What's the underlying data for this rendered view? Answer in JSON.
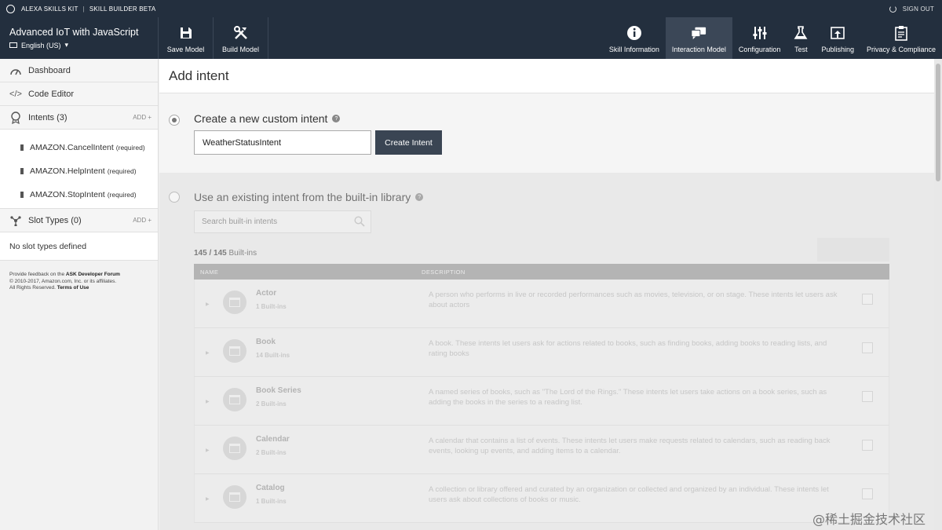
{
  "topbar": {
    "brand": "ALEXA SKILLS KIT",
    "separator": "|",
    "product": "SKILL BUILDER BETA",
    "signout": "SIGN OUT"
  },
  "header": {
    "skill_title": "Advanced IoT with JavaScript",
    "language": "English (US)",
    "left_buttons": [
      {
        "label": "Save Model",
        "icon": "save-icon"
      },
      {
        "label": "Build Model",
        "icon": "tools-icon"
      }
    ],
    "right_buttons": [
      {
        "label": "Skill Information",
        "icon": "info-icon"
      },
      {
        "label": "Interaction Model",
        "icon": "chat-icon",
        "active": true
      },
      {
        "label": "Configuration",
        "icon": "sliders-icon"
      },
      {
        "label": "Test",
        "icon": "flask-icon"
      },
      {
        "label": "Publishing",
        "icon": "upload-icon"
      },
      {
        "label": "Privacy & Compliance",
        "icon": "clipboard-icon"
      }
    ]
  },
  "sidebar": {
    "dashboard": "Dashboard",
    "code_editor": "Code Editor",
    "intents_label": "Intents (3)",
    "add_label": "ADD +",
    "intents": [
      {
        "name": "AMAZON.CancelIntent",
        "tag": "(required)"
      },
      {
        "name": "AMAZON.HelpIntent",
        "tag": "(required)"
      },
      {
        "name": "AMAZON.StopIntent",
        "tag": "(required)"
      }
    ],
    "slot_types_label": "Slot Types (0)",
    "no_slots": "No slot types defined",
    "feedback": {
      "line1_pre": "Provide feedback on the ",
      "line1_link": "ASK Developer Forum",
      "line2": "© 2010-2017, Amazon.com, Inc. or its affiliates.",
      "line3_pre": "All Rights Reserved. ",
      "line3_link": "Terms of Use"
    }
  },
  "main": {
    "page_title": "Add intent",
    "custom": {
      "label": "Create a new custom intent",
      "input_value": "WeatherStatusIntent",
      "button": "Create Intent"
    },
    "library": {
      "label": "Use an existing intent from the built-in library",
      "search_placeholder": "Search built-in intents",
      "count_bold": "145 / 145",
      "count_rest": " Built-ins",
      "columns": {
        "name": "NAME",
        "description": "DESCRIPTION"
      },
      "rows": [
        {
          "name": "Actor",
          "sub": "1 Built-ins",
          "desc": "A person who performs in live or recorded performances such as movies, television, or on stage. These intents let users ask about actors"
        },
        {
          "name": "Book",
          "sub": "14 Built-ins",
          "desc": "A book. These intents let users ask for actions related to books, such as finding books, adding books to reading lists, and rating books"
        },
        {
          "name": "Book Series",
          "sub": "2 Built-ins",
          "desc": "A named series of books, such as \"The Lord of the Rings.\" These intents let users take actions on a book series, such as adding the books in the series to a reading list."
        },
        {
          "name": "Calendar",
          "sub": "2 Built-ins",
          "desc": "A calendar that contains a list of events. These intents let users make requests related to calendars, such as reading back events, looking up events, and adding items to a calendar."
        },
        {
          "name": "Catalog",
          "sub": "1 Built-ins",
          "desc": "A collection or library offered and curated by an organization or collected and organized by an individual. These intents let users ask about collections of books or music."
        }
      ]
    }
  },
  "watermark": "@稀土掘金技术社区"
}
